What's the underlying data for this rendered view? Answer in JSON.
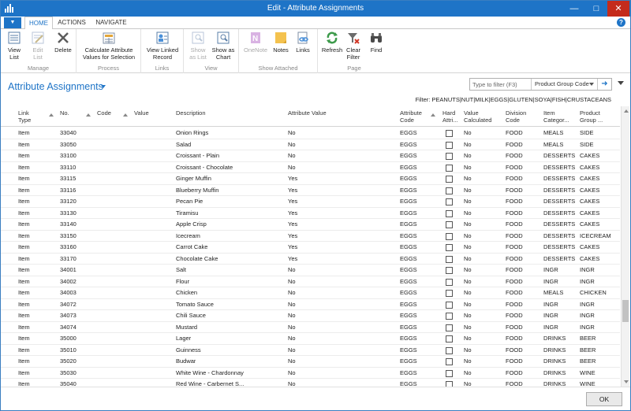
{
  "window": {
    "title": "Edit - Attribute Assignments",
    "accent": "#1e74c7"
  },
  "ribbon_tabs": [
    {
      "label": "HOME",
      "active": true
    },
    {
      "label": "ACTIONS",
      "active": false
    },
    {
      "label": "NAVIGATE",
      "active": false
    }
  ],
  "ribbon": {
    "groups": {
      "manage": "Manage",
      "process": "Process",
      "links": "Links",
      "view": "View",
      "show_attached": "Show Attached",
      "page": "Page"
    },
    "buttons": {
      "view_list": "View List",
      "edit_list": "Edit List",
      "delete": "Delete",
      "calc_attr_1": "Calculate Attribute",
      "calc_attr_2": "Values for Selection",
      "view_linked_1": "View Linked",
      "view_linked_2": "Record",
      "show_as_list_1": "Show",
      "show_as_list_2": "as List",
      "show_as_chart_1": "Show as",
      "show_as_chart_2": "Chart",
      "onenote": "OneNote",
      "notes": "Notes",
      "links": "Links",
      "refresh": "Refresh",
      "clear_filter_1": "Clear",
      "clear_filter_2": "Filter",
      "find": "Find"
    },
    "icons": {
      "view_list": "view-list-icon",
      "edit_list": "edit-list-icon",
      "delete": "delete-icon",
      "calc": "calculate-icon",
      "view_linked": "linked-record-icon",
      "show_as_list": "list-view-icon",
      "show_as_chart": "chart-view-icon",
      "onenote": "onenote-icon",
      "notes": "notes-icon",
      "links": "links-icon",
      "refresh": "refresh-icon",
      "clear_filter": "clear-filter-icon",
      "find": "binoculars-icon"
    }
  },
  "page": {
    "title": "Attribute Assignments",
    "search_placeholder": "Type to filter (F3)",
    "filter_field": "Product Group Code",
    "filter_text": "Filter: PEANUTS|NUT|MILK|EGGS|GLUTEN|SOYA|FISH|CRUSTACEANS"
  },
  "columns": {
    "link_type_1": "Link",
    "link_type_2": "Type",
    "no": "No.",
    "code": "Code",
    "value": "Value",
    "description": "Description",
    "attribute_value": "Attribute Value",
    "attribute_code_1": "Attribute",
    "attribute_code_2": "Code",
    "hard_1": "Hard",
    "hard_2": "Attri...",
    "value_calc_1": "Value",
    "value_calc_2": "Calculated",
    "division_1": "Division",
    "division_2": "Code",
    "item_cat_1": "Item",
    "item_cat_2": "Categor...",
    "product_group_1": "Product",
    "product_group_2": "Group ..."
  },
  "rows": [
    {
      "link_type": "Item",
      "no": "33040",
      "description": "Onion Rings",
      "attribute_value": "No",
      "attribute_code": "EGGS",
      "value_calculated": "No",
      "division": "FOOD",
      "item_category": "MEALS",
      "product_group": "SIDE"
    },
    {
      "link_type": "Item",
      "no": "33050",
      "description": "Salad",
      "attribute_value": "No",
      "attribute_code": "EGGS",
      "value_calculated": "No",
      "division": "FOOD",
      "item_category": "MEALS",
      "product_group": "SIDE"
    },
    {
      "link_type": "Item",
      "no": "33100",
      "description": "Croissant - Plain",
      "attribute_value": "No",
      "attribute_code": "EGGS",
      "value_calculated": "No",
      "division": "FOOD",
      "item_category": "DESSERTS",
      "product_group": "CAKES"
    },
    {
      "link_type": "Item",
      "no": "33110",
      "description": "Croissant - Chocolate",
      "attribute_value": "No",
      "attribute_code": "EGGS",
      "value_calculated": "No",
      "division": "FOOD",
      "item_category": "DESSERTS",
      "product_group": "CAKES"
    },
    {
      "link_type": "Item",
      "no": "33115",
      "description": "Ginger Muffin",
      "attribute_value": "Yes",
      "attribute_code": "EGGS",
      "value_calculated": "No",
      "division": "FOOD",
      "item_category": "DESSERTS",
      "product_group": "CAKES"
    },
    {
      "link_type": "Item",
      "no": "33116",
      "description": "Blueberry Muffin",
      "attribute_value": "Yes",
      "attribute_code": "EGGS",
      "value_calculated": "No",
      "division": "FOOD",
      "item_category": "DESSERTS",
      "product_group": "CAKES"
    },
    {
      "link_type": "Item",
      "no": "33120",
      "description": "Pecan Pie",
      "attribute_value": "Yes",
      "attribute_code": "EGGS",
      "value_calculated": "No",
      "division": "FOOD",
      "item_category": "DESSERTS",
      "product_group": "CAKES"
    },
    {
      "link_type": "Item",
      "no": "33130",
      "description": "Tiramisu",
      "attribute_value": "Yes",
      "attribute_code": "EGGS",
      "value_calculated": "No",
      "division": "FOOD",
      "item_category": "DESSERTS",
      "product_group": "CAKES"
    },
    {
      "link_type": "Item",
      "no": "33140",
      "description": "Apple Crisp",
      "attribute_value": "Yes",
      "attribute_code": "EGGS",
      "value_calculated": "No",
      "division": "FOOD",
      "item_category": "DESSERTS",
      "product_group": "CAKES"
    },
    {
      "link_type": "Item",
      "no": "33150",
      "description": "Icecream",
      "attribute_value": "Yes",
      "attribute_code": "EGGS",
      "value_calculated": "No",
      "division": "FOOD",
      "item_category": "DESSERTS",
      "product_group": "ICECREAM"
    },
    {
      "link_type": "Item",
      "no": "33160",
      "description": "Carrot Cake",
      "attribute_value": "Yes",
      "attribute_code": "EGGS",
      "value_calculated": "No",
      "division": "FOOD",
      "item_category": "DESSERTS",
      "product_group": "CAKES"
    },
    {
      "link_type": "Item",
      "no": "33170",
      "description": "Chocolate Cake",
      "attribute_value": "Yes",
      "attribute_code": "EGGS",
      "value_calculated": "No",
      "division": "FOOD",
      "item_category": "DESSERTS",
      "product_group": "CAKES"
    },
    {
      "link_type": "Item",
      "no": "34001",
      "description": "Salt",
      "attribute_value": "No",
      "attribute_code": "EGGS",
      "value_calculated": "No",
      "division": "FOOD",
      "item_category": "INGR",
      "product_group": "INGR"
    },
    {
      "link_type": "Item",
      "no": "34002",
      "description": "Flour",
      "attribute_value": "No",
      "attribute_code": "EGGS",
      "value_calculated": "No",
      "division": "FOOD",
      "item_category": "INGR",
      "product_group": "INGR"
    },
    {
      "link_type": "Item",
      "no": "34003",
      "description": "Chicken",
      "attribute_value": "No",
      "attribute_code": "EGGS",
      "value_calculated": "No",
      "division": "FOOD",
      "item_category": "MEALS",
      "product_group": "CHICKEN"
    },
    {
      "link_type": "Item",
      "no": "34072",
      "description": "Tomato Sauce",
      "attribute_value": "No",
      "attribute_code": "EGGS",
      "value_calculated": "No",
      "division": "FOOD",
      "item_category": "INGR",
      "product_group": "INGR"
    },
    {
      "link_type": "Item",
      "no": "34073",
      "description": "Chili Sauce",
      "attribute_value": "No",
      "attribute_code": "EGGS",
      "value_calculated": "No",
      "division": "FOOD",
      "item_category": "INGR",
      "product_group": "INGR"
    },
    {
      "link_type": "Item",
      "no": "34074",
      "description": "Mustard",
      "attribute_value": "No",
      "attribute_code": "EGGS",
      "value_calculated": "No",
      "division": "FOOD",
      "item_category": "INGR",
      "product_group": "INGR"
    },
    {
      "link_type": "Item",
      "no": "35000",
      "description": "Lager",
      "attribute_value": "No",
      "attribute_code": "EGGS",
      "value_calculated": "No",
      "division": "FOOD",
      "item_category": "DRINKS",
      "product_group": "BEER"
    },
    {
      "link_type": "Item",
      "no": "35010",
      "description": "Guinness",
      "attribute_value": "No",
      "attribute_code": "EGGS",
      "value_calculated": "No",
      "division": "FOOD",
      "item_category": "DRINKS",
      "product_group": "BEER"
    },
    {
      "link_type": "Item",
      "no": "35020",
      "description": "Budwar",
      "attribute_value": "No",
      "attribute_code": "EGGS",
      "value_calculated": "No",
      "division": "FOOD",
      "item_category": "DRINKS",
      "product_group": "BEER"
    },
    {
      "link_type": "Item",
      "no": "35030",
      "description": "White Wine - Chardonnay",
      "attribute_value": "No",
      "attribute_code": "EGGS",
      "value_calculated": "No",
      "division": "FOOD",
      "item_category": "DRINKS",
      "product_group": "WINE"
    },
    {
      "link_type": "Item",
      "no": "35040",
      "description": "Red Wine - Carbernet S...",
      "attribute_value": "No",
      "attribute_code": "EGGS",
      "value_calculated": "No",
      "division": "FOOD",
      "item_category": "DRINKS",
      "product_group": "WINE"
    }
  ],
  "footer": {
    "ok_label": "OK"
  }
}
